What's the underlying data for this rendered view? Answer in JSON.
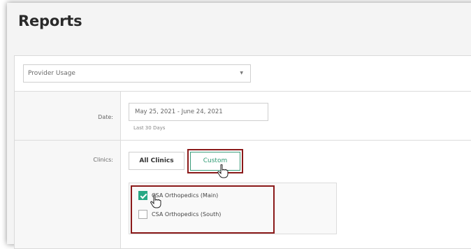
{
  "page": {
    "title": "Reports"
  },
  "report_select": {
    "value": "Provider Usage"
  },
  "date": {
    "label": "Date:",
    "value": "May 25, 2021 - June 24, 2021",
    "hint": "Last 30 Days"
  },
  "clinics": {
    "label": "Clinics:",
    "buttons": {
      "all": "All Clinics",
      "custom": "Custom"
    },
    "options": [
      {
        "label": "CSA Orthopedics (Main)",
        "checked": true
      },
      {
        "label": "CSA Orthopedics (South)",
        "checked": false
      }
    ]
  },
  "colors": {
    "accent": "#27a884",
    "highlight": "#8b1a1a"
  },
  "icons": {
    "select_caret": "caret-down-icon",
    "cursor": "hand-pointer-icon"
  }
}
